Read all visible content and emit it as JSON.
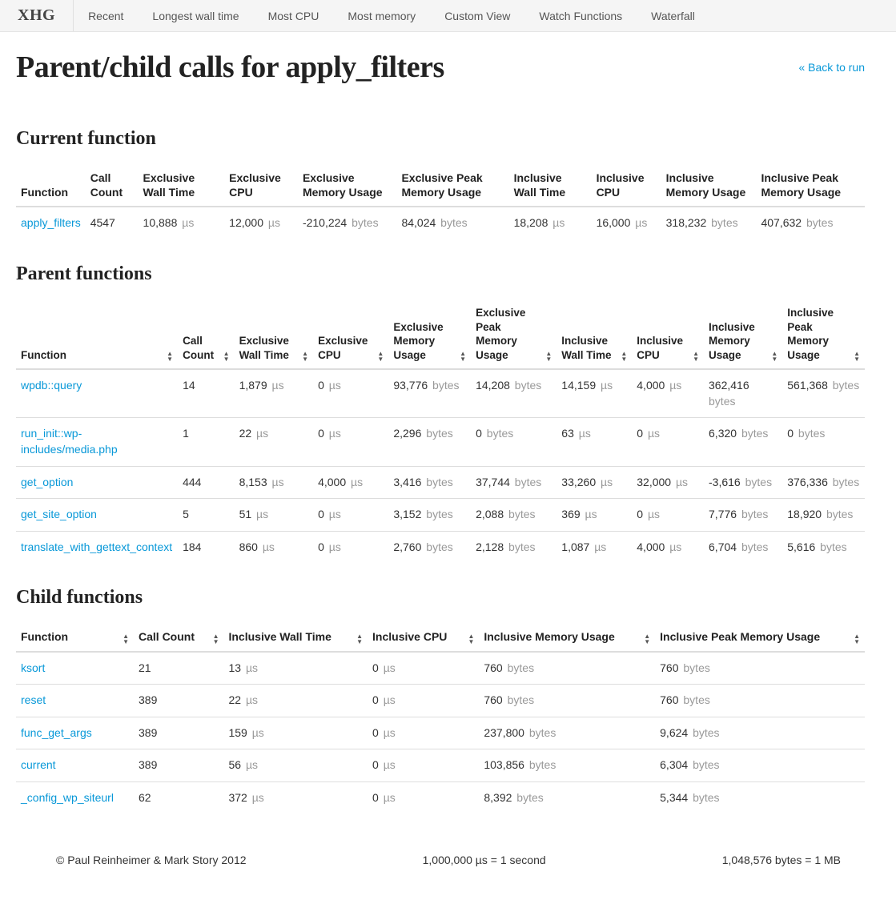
{
  "brand": "XHG",
  "nav": [
    "Recent",
    "Longest wall time",
    "Most CPU",
    "Most memory",
    "Custom View",
    "Watch Functions",
    "Waterfall"
  ],
  "page_title": "Parent/child calls for apply_filters",
  "back_link": "« Back to run",
  "headings": {
    "current": "Current function",
    "parent": "Parent functions",
    "child": "Child functions"
  },
  "cols_full": [
    "Function",
    "Call Count",
    "Exclusive Wall Time",
    "Exclusive CPU",
    "Exclusive Memory Usage",
    "Exclusive Peak Memory Usage",
    "Inclusive Wall Time",
    "Inclusive CPU",
    "Inclusive Memory Usage",
    "Inclusive Peak Memory Usage"
  ],
  "cols_child": [
    "Function",
    "Call Count",
    "Inclusive Wall Time",
    "Inclusive CPU",
    "Inclusive Memory Usage",
    "Inclusive Peak Memory Usage"
  ],
  "units": {
    "us": "µs",
    "bytes": "bytes"
  },
  "current": [
    {
      "fn": "apply_filters",
      "cc": "4547",
      "ewt": "10,888",
      "ecpu": "12,000",
      "emu": "-210,224",
      "epmu": "84,024",
      "iwt": "18,208",
      "icpu": "16,000",
      "imu": "318,232",
      "ipmu": "407,632"
    }
  ],
  "parents": [
    {
      "fn": "wpdb::query",
      "cc": "14",
      "ewt": "1,879",
      "ecpu": "0",
      "emu": "93,776",
      "epmu": "14,208",
      "iwt": "14,159",
      "icpu": "4,000",
      "imu": "362,416",
      "ipmu": "561,368"
    },
    {
      "fn": "run_init::wp-includes/media.php",
      "cc": "1",
      "ewt": "22",
      "ecpu": "0",
      "emu": "2,296",
      "epmu": "0",
      "iwt": "63",
      "icpu": "0",
      "imu": "6,320",
      "ipmu": "0"
    },
    {
      "fn": "get_option",
      "cc": "444",
      "ewt": "8,153",
      "ecpu": "4,000",
      "emu": "3,416",
      "epmu": "37,744",
      "iwt": "33,260",
      "icpu": "32,000",
      "imu": "-3,616",
      "ipmu": "376,336"
    },
    {
      "fn": "get_site_option",
      "cc": "5",
      "ewt": "51",
      "ecpu": "0",
      "emu": "3,152",
      "epmu": "2,088",
      "iwt": "369",
      "icpu": "0",
      "imu": "7,776",
      "ipmu": "18,920"
    },
    {
      "fn": "translate_with_gettext_context",
      "cc": "184",
      "ewt": "860",
      "ecpu": "0",
      "emu": "2,760",
      "epmu": "2,128",
      "iwt": "1,087",
      "icpu": "4,000",
      "imu": "6,704",
      "ipmu": "5,616"
    }
  ],
  "children": [
    {
      "fn": "ksort",
      "cc": "21",
      "iwt": "13",
      "icpu": "0",
      "imu": "760",
      "ipmu": "760"
    },
    {
      "fn": "reset",
      "cc": "389",
      "iwt": "22",
      "icpu": "0",
      "imu": "760",
      "ipmu": "760"
    },
    {
      "fn": "func_get_args",
      "cc": "389",
      "iwt": "159",
      "icpu": "0",
      "imu": "237,800",
      "ipmu": "9,624"
    },
    {
      "fn": "current",
      "cc": "389",
      "iwt": "56",
      "icpu": "0",
      "imu": "103,856",
      "ipmu": "6,304"
    },
    {
      "fn": "_config_wp_siteurl",
      "cc": "62",
      "iwt": "372",
      "icpu": "0",
      "imu": "8,392",
      "ipmu": "5,344"
    }
  ],
  "footer": {
    "left": "© Paul Reinheimer & Mark Story 2012",
    "mid": "1,000,000 µs = 1 second",
    "right": "1,048,576 bytes = 1 MB"
  }
}
